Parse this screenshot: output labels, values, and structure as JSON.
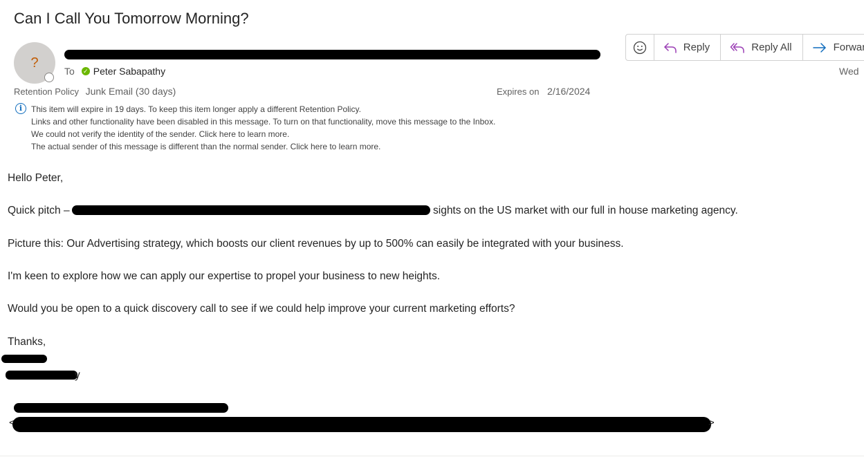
{
  "subject": "Can I Call You Tomorrow Morning?",
  "avatar": {
    "initial": "?"
  },
  "to_label": "To",
  "recipient": "Peter Sabapathy",
  "retention": {
    "label": "Retention Policy",
    "value": "Junk Email (30 days)"
  },
  "expires": {
    "label": "Expires on",
    "value": "2/16/2024"
  },
  "toolbar": {
    "emoji_icon": "smiley-icon",
    "reply_label": "Reply",
    "reply_all_label": "Reply All",
    "forward_label": "Forward"
  },
  "date_label": "Wed",
  "info_lines": [
    "This item will expire in 19 days. To keep this item longer apply a different Retention Policy.",
    "Links and other functionality have been disabled in this message. To turn on that functionality, move this message to the Inbox.",
    "We could not verify the identity of the sender. Click here to learn more.",
    "The actual sender of this message is different than the normal sender. Click here to learn more."
  ],
  "body": {
    "greeting": "Hello Peter,",
    "pitch_start": "Quick pitch –",
    "pitch_end": "sights on the US market with our full in house marketing agency.",
    "para2": "Picture this: Our Advertising strategy, which boosts our client revenues by up to 500% can easily be integrated with your business.",
    "para3": "I'm keen to explore how we can apply our expertise to propel your business to new heights.",
    "para4": "Would you be open to a quick discovery call to see if we could help improve your current marketing efforts?",
    "sign_off": "Thanks,",
    "sig_tail": "y"
  },
  "colors": {
    "accent": "#0f6cbd",
    "reply_icon": "#9b3fb5",
    "presence_green": "#6bb700"
  }
}
